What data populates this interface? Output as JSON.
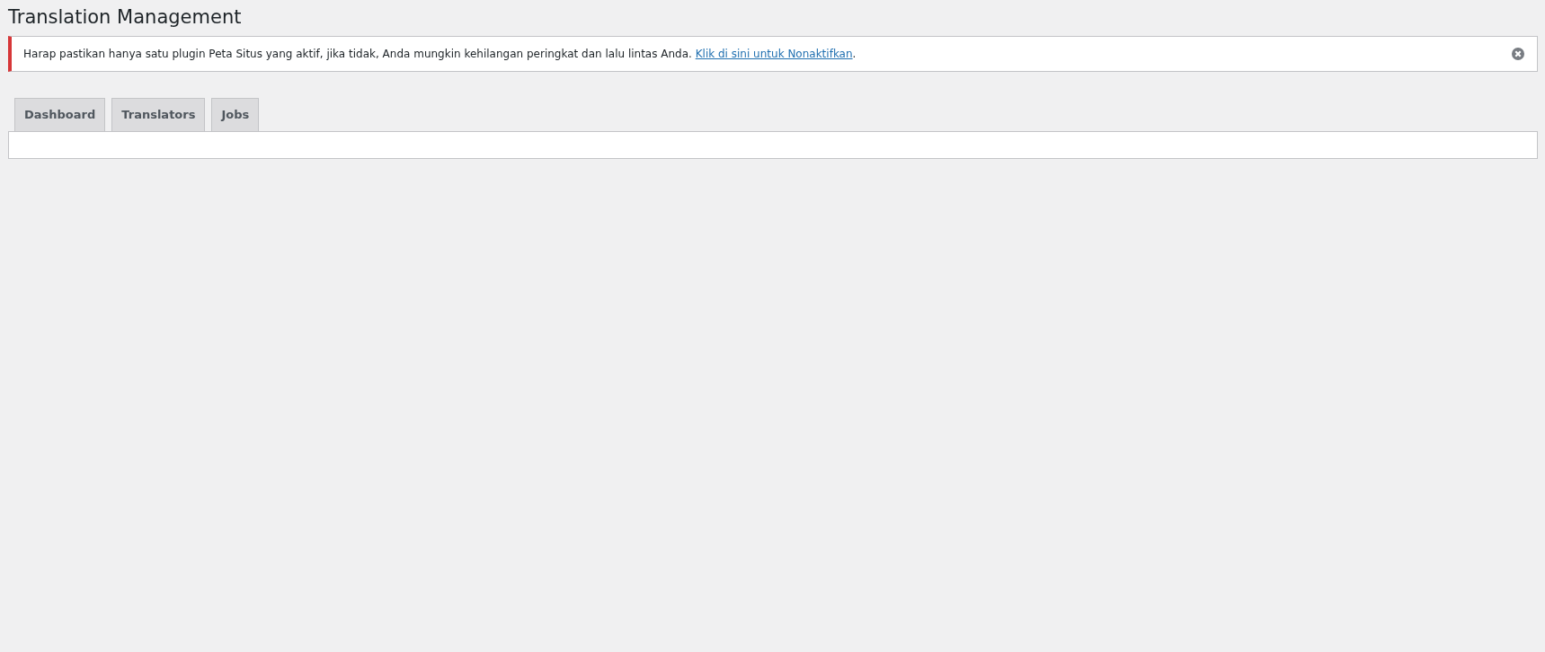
{
  "page_title": "Translation Management",
  "notice": {
    "message": "Harap pastikan hanya satu plugin Peta Situs yang aktif, jika tidak, Anda mungkin kehilangan peringkat dan lalu lintas Anda.",
    "link": "Klik di sini untuk Nonaktifkan",
    "after_link": ".",
    "dismissible": true
  },
  "tabs": [
    {
      "label": "Dashboard",
      "selected": false
    },
    {
      "label": "Translators",
      "selected": false
    },
    {
      "label": "Jobs",
      "selected": false
    }
  ]
}
